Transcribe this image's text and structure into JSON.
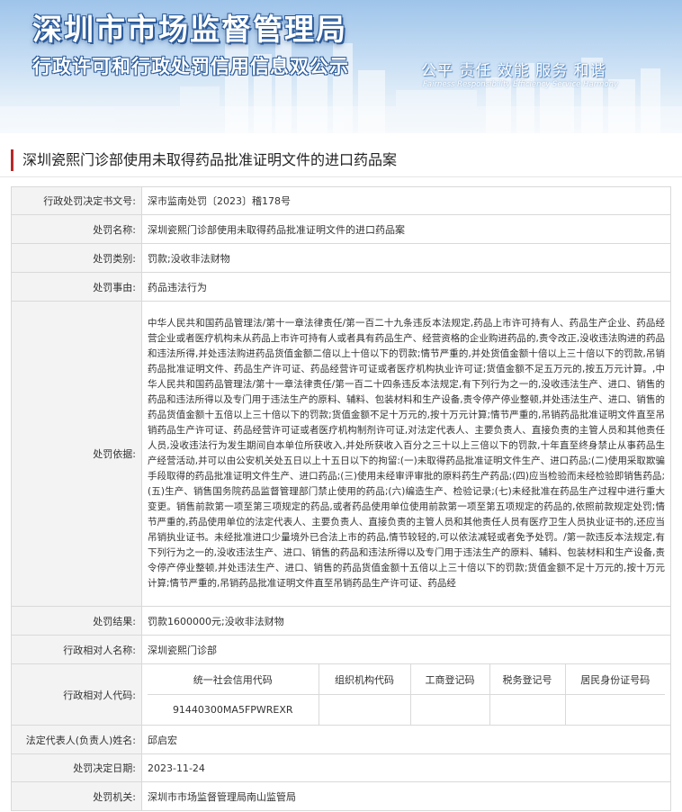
{
  "header": {
    "title": "深圳市市场监督管理局",
    "subtitle": "行政许可和行政处罚信用信息双公示",
    "slogan": "公平  责任  效能  服务  和谐",
    "slogan_en": "Fairness  Responsibility  Efficiency  Service  Harmony"
  },
  "case_title": "深圳瓷熙门诊部使用未取得药品批准证明文件的进口药品案",
  "fields": {
    "decision_no": {
      "label": "行政处罚决定书文号:",
      "value": "深市监南处罚〔2023〕稽178号"
    },
    "penalty_name": {
      "label": "处罚名称:",
      "value": "深圳瓷熙门诊部使用未取得药品批准证明文件的进口药品案"
    },
    "penalty_type": {
      "label": "处罚类别:",
      "value": "罚款;没收非法财物"
    },
    "penalty_reason": {
      "label": "处罚事由:",
      "value": "药品违法行为"
    },
    "penalty_basis": {
      "label": "处罚依据:",
      "value": "中华人民共和国药品管理法/第十一章法律责任/第一百二十九条违反本法规定,药品上市许可持有人、药品生产企业、药品经营企业或者医疗机构未从药品上市许可持有人或者具有药品生产、经营资格的企业购进药品的,责令改正,没收违法购进的药品和违法所得,并处违法购进药品货值金额二倍以上十倍以下的罚款;情节严重的,并处货值金额十倍以上三十倍以下的罚款,吊销药品批准证明文件、药品生产许可证、药品经营许可证或者医疗机构执业许可证;货值金额不足五万元的,按五万元计算。,中华人民共和国药品管理法/第十一章法律责任/第一百二十四条违反本法规定,有下列行为之一的,没收违法生产、进口、销售的药品和违法所得以及专门用于违法生产的原料、辅料、包装材料和生产设备,责令停产停业整顿,并处违法生产、进口、销售的药品货值金额十五倍以上三十倍以下的罚款;货值金额不足十万元的,按十万元计算;情节严重的,吊销药品批准证明文件直至吊销药品生产许可证、药品经营许可证或者医疗机构制剂许可证,对法定代表人、主要负责人、直接负责的主管人员和其他责任人员,没收违法行为发生期间自本单位所获收入,并处所获收入百分之三十以上三倍以下的罚款,十年直至终身禁止从事药品生产经营活动,并可以由公安机关处五日以上十五日以下的拘留:(一)未取得药品批准证明文件生产、进口药品;(二)使用采取欺骗手段取得的药品批准证明文件生产、进口药品;(三)使用未经审评审批的原料药生产药品;(四)应当检验而未经检验即销售药品;(五)生产、销售国务院药品监督管理部门禁止使用的药品;(六)编造生产、检验记录;(七)未经批准在药品生产过程中进行重大变更。销售前款第一项至第三项规定的药品,或者药品使用单位使用前款第一项至第五项规定的药品的,依照前款规定处罚;情节严重的,药品使用单位的法定代表人、主要负责人、直接负责的主管人员和其他责任人员有医疗卫生人员执业证书的,还应当吊销执业证书。未经批准进口少量境外已合法上市的药品,情节较轻的,可以依法减轻或者免予处罚。/第一款违反本法规定,有下列行为之一的,没收违法生产、进口、销售的药品和违法所得以及专门用于违法生产的原料、辅料、包装材料和生产设备,责令停产停业整顿,并处违法生产、进口、销售的药品货值金额十五倍以上三十倍以下的罚款;货值金额不足十万元的,按十万元计算;情节严重的,吊销药品批准证明文件直至吊销药品生产许可证、药品经"
    },
    "penalty_result": {
      "label": "处罚结果:",
      "value": "罚款1600000元;没收非法财物"
    },
    "counterpart_name": {
      "label": "行政相对人名称:",
      "value": "深圳瓷熙门诊部"
    },
    "counterpart_code": {
      "label": "行政相对人代码:",
      "headers": [
        "统一社会信用代码",
        "组织机构代码",
        "工商登记码",
        "税务登记号",
        "居民身份证号码"
      ],
      "values": [
        "91440300MA5FPWREXR",
        "",
        "",
        "",
        ""
      ]
    },
    "legal_rep": {
      "label": "法定代表人(负责人)姓名:",
      "value": "邱启宏"
    },
    "decision_date": {
      "label": "处罚决定日期:",
      "value": "2023-11-24"
    },
    "authority": {
      "label": "处罚机关:",
      "value": "深圳市市场监督管理局南山监管局"
    }
  },
  "colors": {
    "accent_bar": "#b62a2a",
    "banner_blue": "#2a5a9a"
  }
}
